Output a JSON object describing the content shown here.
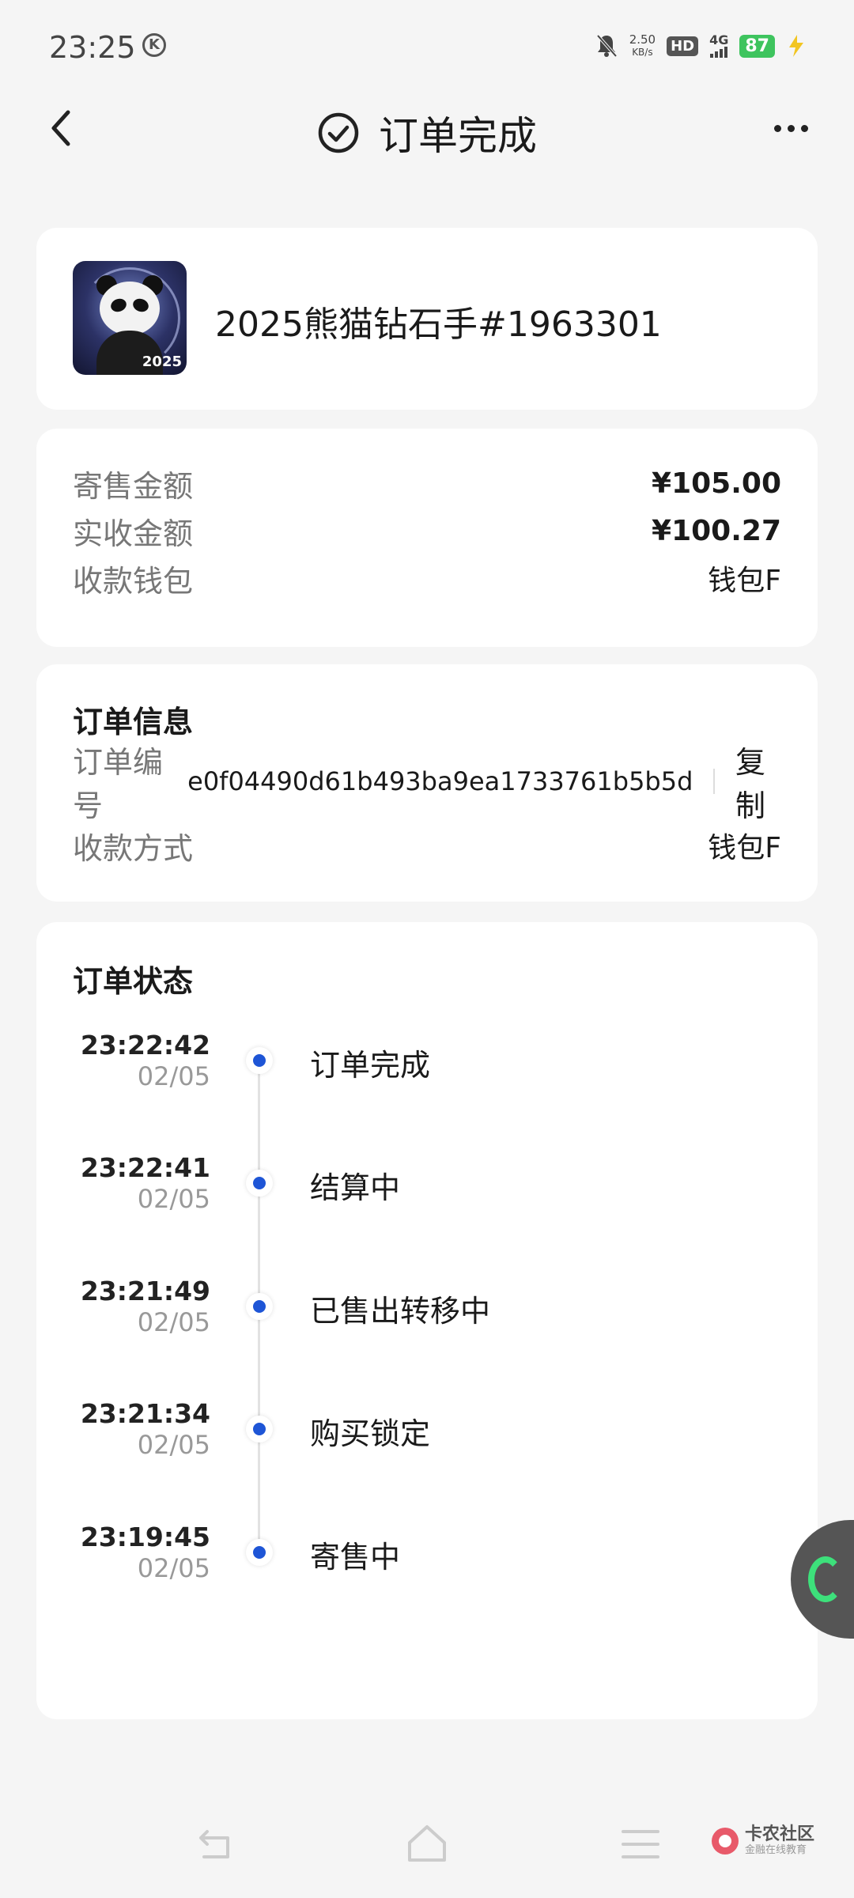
{
  "status_bar": {
    "time": "23:25",
    "k_icon": "K",
    "net_speed_value": "2.50",
    "net_speed_unit": "KB/s",
    "hd": "HD",
    "network": "4G",
    "battery": "87"
  },
  "header": {
    "title": "订单完成"
  },
  "product": {
    "name": "2025熊猫钻石手#1963301",
    "image_year": "2025"
  },
  "amounts": {
    "sale_label": "寄售金额",
    "sale_value": "¥105.00",
    "received_label": "实收金额",
    "received_value": "¥100.27",
    "wallet_label": "收款钱包",
    "wallet_value": "钱包F"
  },
  "order_info": {
    "title": "订单信息",
    "order_no_label": "订单编号",
    "order_no": "e0f04490d61b493ba9ea1733761b5b5d",
    "copy_label": "复制",
    "payment_label": "收款方式",
    "payment_value": "钱包F"
  },
  "order_status": {
    "title": "订单状态",
    "items": [
      {
        "time": "23:22:42",
        "date": "02/05",
        "label": "订单完成"
      },
      {
        "time": "23:22:41",
        "date": "02/05",
        "label": "结算中"
      },
      {
        "time": "23:21:49",
        "date": "02/05",
        "label": "已售出转移中"
      },
      {
        "time": "23:21:34",
        "date": "02/05",
        "label": "购买锁定"
      },
      {
        "time": "23:19:45",
        "date": "02/05",
        "label": "寄售中"
      }
    ]
  },
  "watermark": {
    "title": "卡农社区",
    "subtitle": "金融在线教育"
  },
  "colors": {
    "accent": "#1e55d6",
    "battery": "#3ec45e",
    "background": "#f5f5f5"
  }
}
